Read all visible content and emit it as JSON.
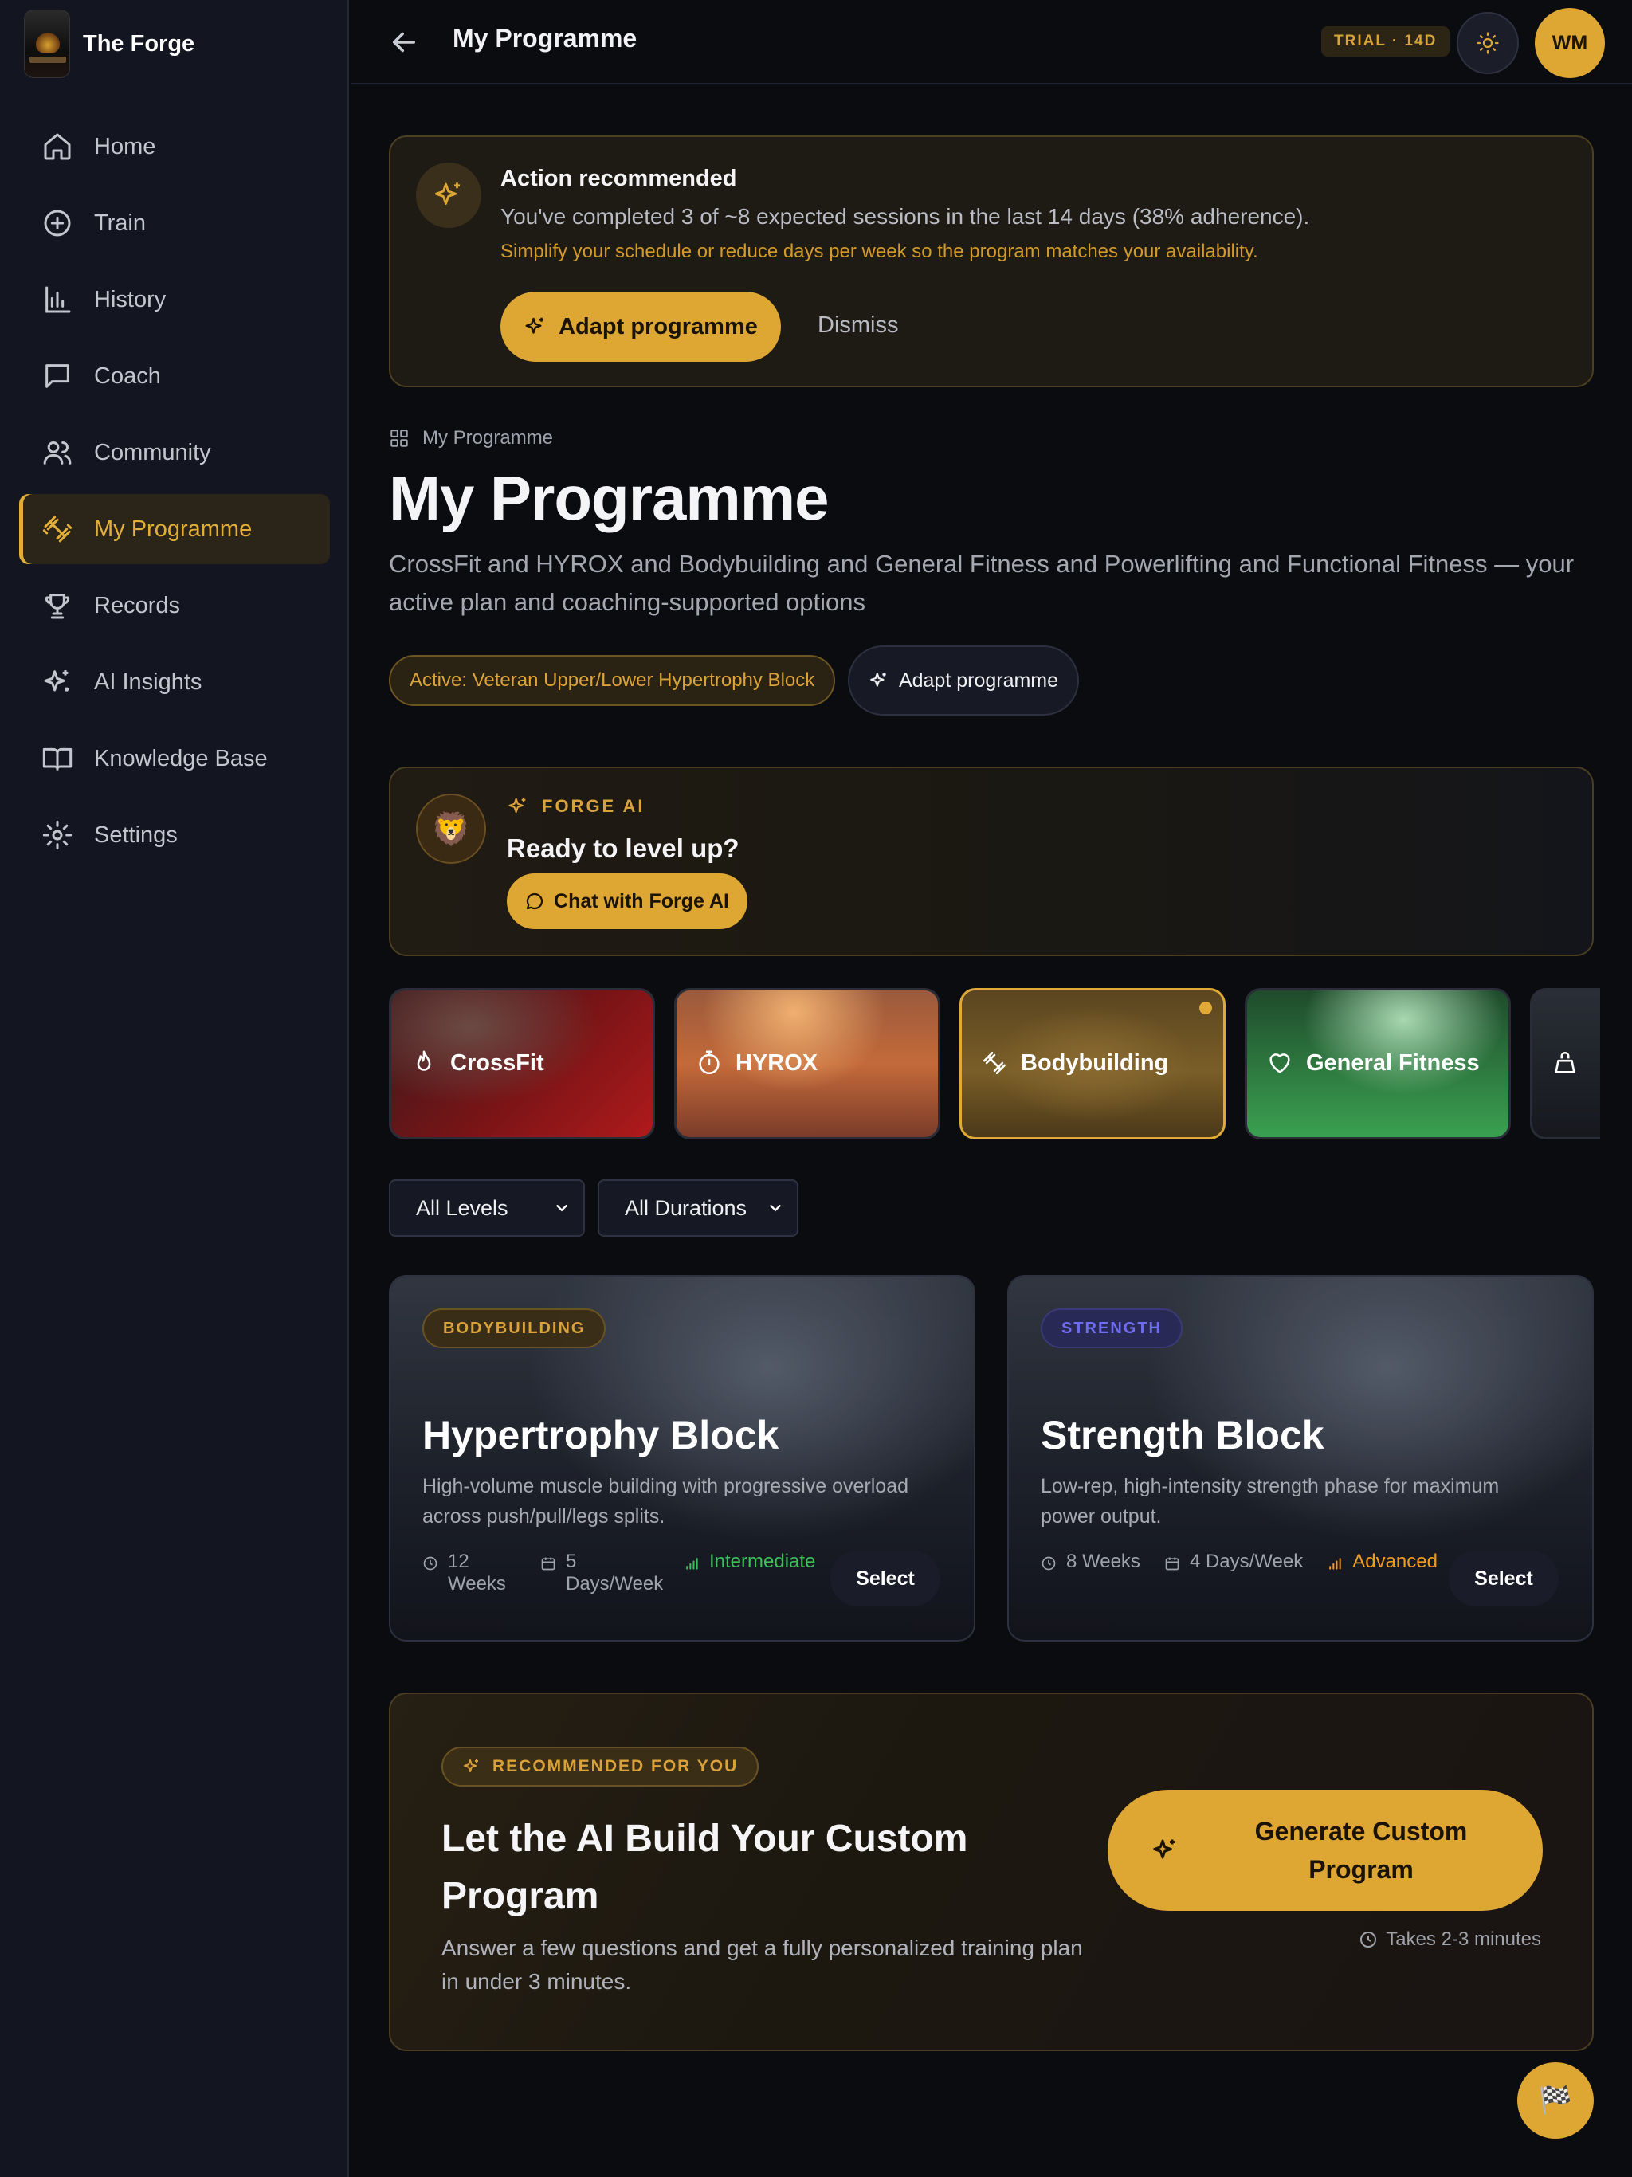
{
  "brand": {
    "name": "The Forge"
  },
  "sidebar": {
    "items": [
      {
        "label": "Home",
        "icon": "home-icon"
      },
      {
        "label": "Train",
        "icon": "plus-circle-icon"
      },
      {
        "label": "History",
        "icon": "bar-chart-icon"
      },
      {
        "label": "Coach",
        "icon": "chat-icon"
      },
      {
        "label": "Community",
        "icon": "users-icon"
      },
      {
        "label": "My Programme",
        "icon": "dumbbell-icon",
        "active": true
      },
      {
        "label": "Records",
        "icon": "trophy-icon"
      },
      {
        "label": "AI Insights",
        "icon": "sparkles-icon"
      },
      {
        "label": "Knowledge Base",
        "icon": "book-icon"
      },
      {
        "label": "Settings",
        "icon": "gear-icon"
      }
    ]
  },
  "topbar": {
    "title": "My Programme",
    "trial": "TRIAL · 14D",
    "avatar": "WM"
  },
  "alert": {
    "title": "Action recommended",
    "body": "You've completed 3 of ~8 expected sessions in the last 14 days (38% adherence).",
    "hint": "Simplify your schedule or reduce days per week so the program matches your availability.",
    "adapt_label": "Adapt programme",
    "dismiss_label": "Dismiss"
  },
  "page": {
    "breadcrumb": "My Programme",
    "title": "My Programme",
    "subtitle": "CrossFit and HYROX and Bodybuilding and General Fitness and Powerlifting and Functional Fitness — your active plan and coaching-supported options",
    "active_pill": "Active: Veteran Upper/Lower Hypertrophy Block",
    "adapt_label": "Adapt programme"
  },
  "forge_ai": {
    "tag": "FORGE AI",
    "title": "Ready to level up?",
    "chat_label": "Chat with Forge AI",
    "avatar_emoji": "🦁"
  },
  "categories": [
    {
      "label": "CrossFit",
      "icon": "flame-icon"
    },
    {
      "label": "HYROX",
      "icon": "stopwatch-icon"
    },
    {
      "label": "Bodybuilding",
      "icon": "dumbbell-icon",
      "selected": true
    },
    {
      "label": "General Fitness",
      "icon": "heart-icon"
    },
    {
      "label": "",
      "icon": "kettlebell-icon"
    }
  ],
  "filters": {
    "level": "All Levels",
    "duration": "All Durations"
  },
  "programs": [
    {
      "badge": "BODYBUILDING",
      "title": "Hypertrophy Block",
      "description": "High-volume muscle building with progressive overload across push/pull/legs splits.",
      "weeks": "12 Weeks",
      "days": "5 Days/Week",
      "level": "Intermediate",
      "select": "Select"
    },
    {
      "badge": "STRENGTH",
      "title": "Strength Block",
      "description": "Low-rep, high-intensity strength phase for maximum power output.",
      "weeks": "8 Weeks",
      "days": "4 Days/Week",
      "level": "Advanced",
      "select": "Select"
    }
  ],
  "recommend": {
    "tag": "RECOMMENDED FOR YOU",
    "title": "Let the AI Build Your Custom Program",
    "description": "Answer a few questions and get a fully personalized training plan in under 3 minutes.",
    "button": "Generate Custom Program",
    "time": "Takes 2-3 minutes"
  },
  "fab": {
    "emoji": "🏁"
  },
  "colors": {
    "accent": "#dea633",
    "background": "#0b0c10",
    "sidebar": "#131621",
    "intermediate": "#3fbf5a",
    "advanced": "#f39a1d",
    "strength_badge": "#6e6cf0"
  }
}
